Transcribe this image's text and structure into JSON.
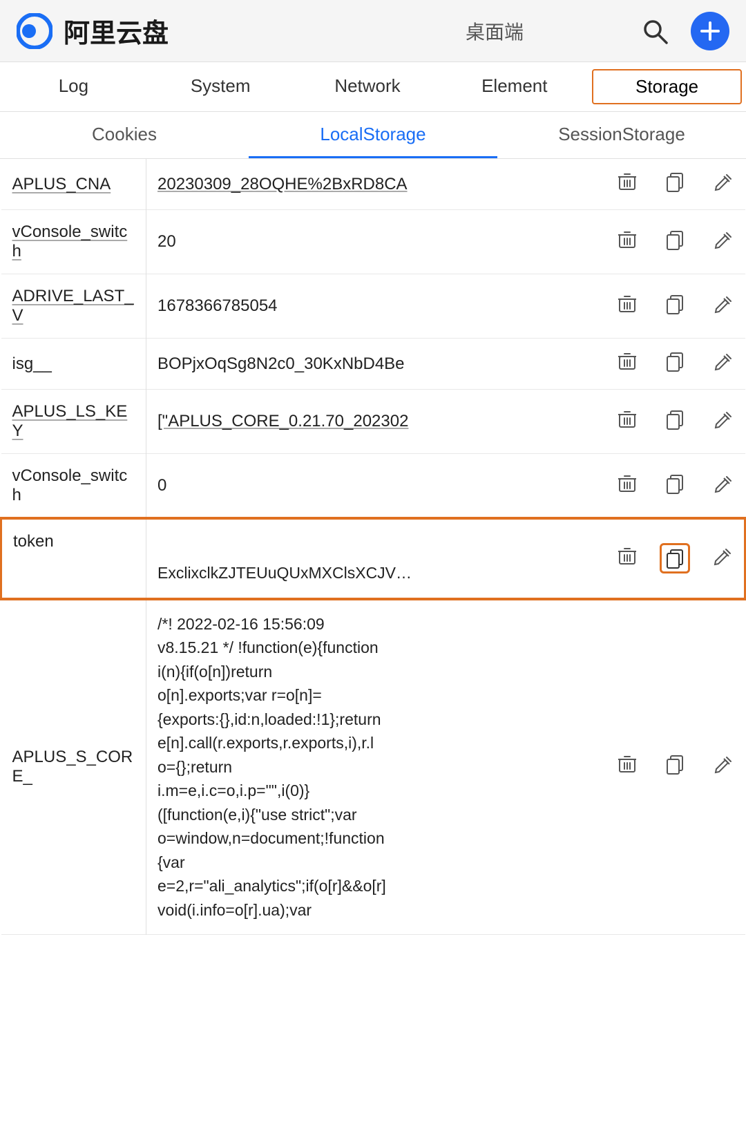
{
  "appBar": {
    "title": "阿里云盘",
    "subtitle": "桌面端",
    "searchLabel": "search",
    "addLabel": "add"
  },
  "devToolsTabs": [
    {
      "id": "log",
      "label": "Log",
      "active": false
    },
    {
      "id": "system",
      "label": "System",
      "active": false
    },
    {
      "id": "network",
      "label": "Network",
      "active": false
    },
    {
      "id": "element",
      "label": "Element",
      "active": false
    },
    {
      "id": "storage",
      "label": "Storage",
      "active": true
    }
  ],
  "storageTabs": [
    {
      "id": "cookies",
      "label": "Cookies",
      "active": false
    },
    {
      "id": "localstorage",
      "label": "LocalStorage",
      "active": true
    },
    {
      "id": "sessionstorage",
      "label": "SessionStorage",
      "active": false
    }
  ],
  "tableRows": [
    {
      "key": "APLUS_CNA",
      "keyUnderline": true,
      "value": "20230309_28OQHE%2BxRD8CA",
      "valueUnderline": true,
      "multiline": false,
      "highlighted": false,
      "copyHighlighted": false
    },
    {
      "key": "vConsole_switch",
      "keyUnderline": true,
      "value": "20",
      "multiline": false,
      "highlighted": false,
      "copyHighlighted": false
    },
    {
      "key": "ADRIVE_LAST_V",
      "keyUnderline": true,
      "value": "1678366785054",
      "multiline": false,
      "highlighted": false,
      "copyHighlighted": false
    },
    {
      "key": "isg__",
      "value": "BOPjxOqSg8N2c0_30KxNbD4Be",
      "multiline": false,
      "highlighted": false,
      "copyHighlighted": false
    },
    {
      "key": "APLUS_LS_KEY",
      "keyUnderline": true,
      "value": "[\"APLUS_CORE_0.21.70_202302",
      "valueUnderline": true,
      "multiline": false,
      "highlighted": false,
      "copyHighlighted": false
    },
    {
      "key": "vConsole_switch",
      "value": "0",
      "multiline": false,
      "highlighted": false,
      "copyHighlighted": false
    },
    {
      "key": "token",
      "value": "ExclixclkZJTEUuQUxMXClsXCJV…",
      "multiline": true,
      "highlighted": true,
      "copyHighlighted": true,
      "valueTop": "",
      "valueBottom": "ExclixclkZJTEUuQUxMXClsXCJV…"
    },
    {
      "key": "APLUS_S_CORE_",
      "value": "/*! 2022-02-16 15:56:09\nv8.15.21 */ !function(e){function\ni(n){if(o[n])return\no[n].exports;var r=o[n]=\n{exports:{},id:n,loaded:!1};return\ne[n].call(r.exports,r.exports,i),r.l\no={};return\ni.m=e,i.c=o,i.p=\"\",i(0)}\n([function(e,i){\"use strict\";var\no=window,n=document;!function\n{var\ne=2,r=\"ali_analytics\";if(o[r]&&o[r]\nvoid(i.info=o[r].ua);var",
      "multiline": true,
      "highlighted": false,
      "copyHighlighted": false
    }
  ],
  "icons": {
    "delete": "🗑",
    "copy": "⧉",
    "edit": "✎",
    "search": "🔍",
    "add": "+"
  }
}
